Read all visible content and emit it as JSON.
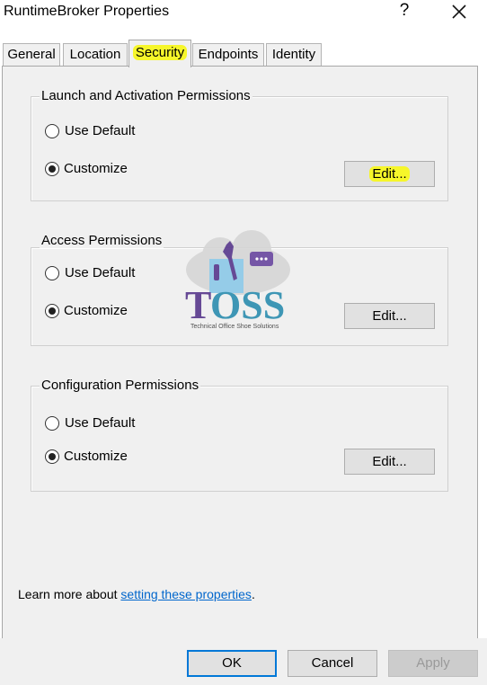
{
  "window": {
    "title": "RuntimeBroker Properties",
    "help": "?",
    "close": "✕"
  },
  "tabs": [
    {
      "label": "General"
    },
    {
      "label": "Location"
    },
    {
      "label": "Security"
    },
    {
      "label": "Endpoints"
    },
    {
      "label": "Identity"
    }
  ],
  "groups": [
    {
      "title": "Launch and Activation Permissions",
      "use_default": "Use Default",
      "customize": "Customize",
      "edit": "Edit..."
    },
    {
      "title": "Access Permissions",
      "use_default": "Use Default",
      "customize": "Customize",
      "edit": "Edit..."
    },
    {
      "title": "Configuration Permissions",
      "use_default": "Use Default",
      "customize": "Customize",
      "edit": "Edit..."
    }
  ],
  "selected_option": "Customize",
  "footer_text": {
    "prefix": "Learn more about ",
    "link": "setting these properties",
    "suffix": "."
  },
  "buttons": {
    "ok": "OK",
    "cancel": "Cancel",
    "apply": "Apply"
  },
  "watermark": {
    "text": "TOSS",
    "subtext": "Technical Office Shoe Solutions"
  },
  "colors": {
    "accent": "#0078d7",
    "link": "#0066cc",
    "highlight": "#f6f62a"
  }
}
